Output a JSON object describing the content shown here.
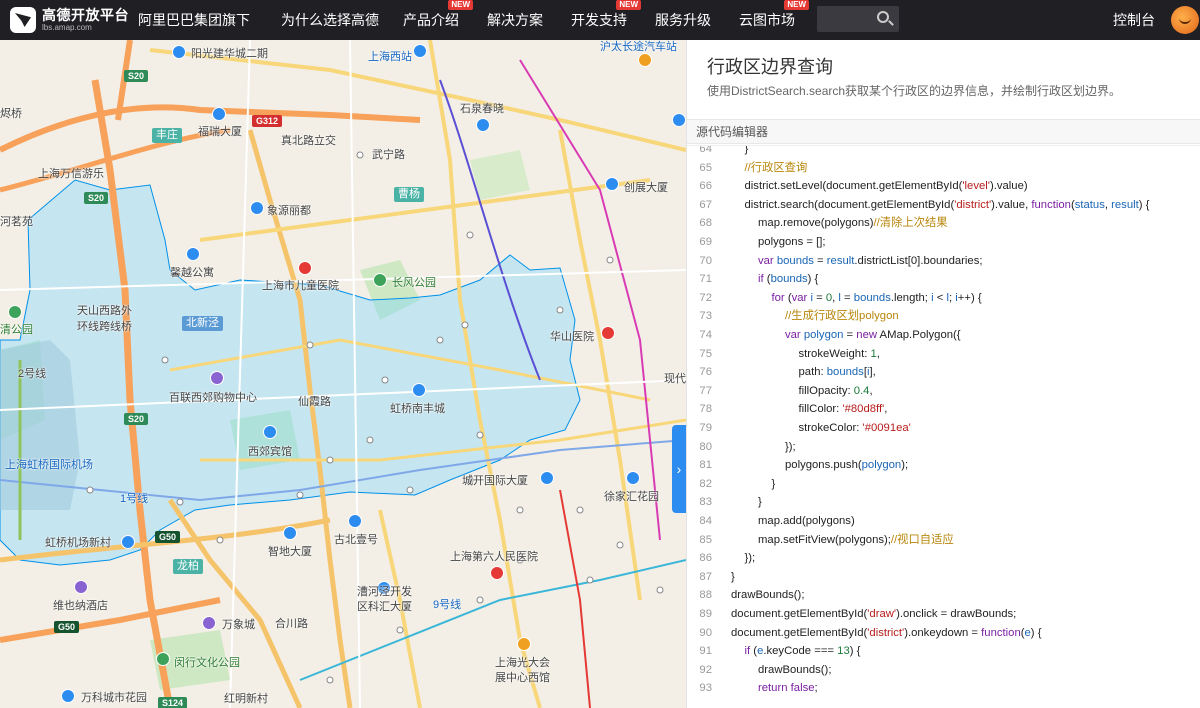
{
  "nav": {
    "logo_title": "高德开放平台",
    "logo_sub": "lbs.amap.com",
    "items": [
      {
        "label": "阿里巴巴集团旗下",
        "badge": ""
      },
      {
        "label": "为什么选择高德",
        "badge": ""
      },
      {
        "label": "产品介绍",
        "badge": "NEW"
      },
      {
        "label": "解决方案",
        "badge": ""
      },
      {
        "label": "开发支持",
        "badge": "NEW"
      },
      {
        "label": "服务升级",
        "badge": ""
      },
      {
        "label": "云图市场",
        "badge": "NEW"
      }
    ],
    "console": "控制台",
    "icons": {
      "search": "search-icon",
      "avatar": "avatar"
    }
  },
  "map": {
    "labels": [
      {
        "text": "阳光建华城二期",
        "cls": ""
      },
      {
        "text": "上海西站",
        "cls": "blue"
      },
      {
        "text": "沪太长途汽车站",
        "cls": "blue"
      },
      {
        "text": "石泉春晓",
        "cls": ""
      },
      {
        "text": "福瑞大厦",
        "cls": ""
      },
      {
        "text": "真北路立交",
        "cls": ""
      },
      {
        "text": "武宁路",
        "cls": ""
      },
      {
        "text": "上海万信游乐",
        "cls": ""
      },
      {
        "text": "创展大厦",
        "cls": ""
      },
      {
        "text": "象源丽都",
        "cls": ""
      },
      {
        "text": "馨越公寓",
        "cls": ""
      },
      {
        "text": "上海市儿童医院",
        "cls": ""
      },
      {
        "text": "长风公园",
        "cls": "green"
      },
      {
        "text": "天山西路外",
        "cls": ""
      },
      {
        "text": "环线跨线桥",
        "cls": ""
      },
      {
        "text": "华山医院",
        "cls": ""
      },
      {
        "text": "清公园",
        "cls": "green"
      },
      {
        "text": "百联西郊购物中心",
        "cls": ""
      },
      {
        "text": "仙霞路",
        "cls": ""
      },
      {
        "text": "虹桥南丰城",
        "cls": ""
      },
      {
        "text": "现代",
        "cls": ""
      },
      {
        "text": "西郊宾馆",
        "cls": ""
      },
      {
        "text": "上海虹桥国际机场",
        "cls": "blue"
      },
      {
        "text": "城开国际大厦",
        "cls": ""
      },
      {
        "text": "徐家汇花园",
        "cls": ""
      },
      {
        "text": "虹桥机场新村",
        "cls": ""
      },
      {
        "text": "智地大厦",
        "cls": ""
      },
      {
        "text": "古北壹号",
        "cls": ""
      },
      {
        "text": "上海第六人民医院",
        "cls": ""
      },
      {
        "text": "维也纳酒店",
        "cls": ""
      },
      {
        "text": "漕河泾开发",
        "cls": ""
      },
      {
        "text": "区科汇大厦",
        "cls": ""
      },
      {
        "text": "万象城",
        "cls": ""
      },
      {
        "text": "闵行文化公园",
        "cls": "green"
      },
      {
        "text": "上海光大会",
        "cls": ""
      },
      {
        "text": "展中心西馆",
        "cls": ""
      },
      {
        "text": "万科城市花园",
        "cls": ""
      },
      {
        "text": "红明新村",
        "cls": ""
      },
      {
        "text": "河茗苑",
        "cls": ""
      },
      {
        "text": "烬桥",
        "cls": ""
      },
      {
        "text": "合川路",
        "cls": ""
      },
      {
        "text": "9号线",
        "cls": "blue"
      },
      {
        "text": "1号线",
        "cls": "blue"
      },
      {
        "text": "2号线",
        "cls": ""
      }
    ],
    "shields": [
      {
        "text": "S20",
        "cls": "green"
      },
      {
        "text": "G312",
        "cls": "red"
      },
      {
        "text": "S20",
        "cls": "green"
      },
      {
        "text": "S20",
        "cls": "green"
      },
      {
        "text": "G50",
        "cls": "darkgreen"
      },
      {
        "text": "G50",
        "cls": "darkgreen"
      },
      {
        "text": "S124",
        "cls": "green"
      }
    ],
    "district_tags": [
      {
        "text": "丰庄",
        "cls": "teal"
      },
      {
        "text": "曹杨",
        "cls": "teal"
      },
      {
        "text": "北新泾",
        "cls": "blue"
      },
      {
        "text": "龙柏",
        "cls": "teal"
      }
    ],
    "polygon_fill": "#80d8ff",
    "polygon_stroke": "#0091ea",
    "collapse_icon": "chevron-right-icon"
  },
  "panel": {
    "title": "行政区边界查询",
    "desc": "使用DistrictSearch.search获取某个行政区的边界信息，并绘制行政区划边界。",
    "editor_header": "源代码编辑器"
  },
  "code_lines": [
    {
      "n": "64",
      "indent": 1,
      "parts": [
        [
          "",
          "}"
        ]
      ]
    },
    {
      "n": "65",
      "indent": 1,
      "parts": [
        [
          "cmt",
          "//行政区查询"
        ]
      ]
    },
    {
      "n": "66",
      "indent": 1,
      "parts": [
        [
          "",
          "district.setLevel(document.getElementById("
        ],
        [
          "str",
          "'level'"
        ],
        [
          "",
          ").value)"
        ]
      ]
    },
    {
      "n": "67",
      "indent": 1,
      "parts": [
        [
          "",
          "district.search(document.getElementById("
        ],
        [
          "str",
          "'district'"
        ],
        [
          "",
          ").value, "
        ],
        [
          "kw",
          "function"
        ],
        [
          "",
          "("
        ],
        [
          "var",
          "status"
        ],
        [
          "",
          ", "
        ],
        [
          "var",
          "result"
        ],
        [
          "",
          ") {"
        ]
      ]
    },
    {
      "n": "68",
      "indent": 2,
      "parts": [
        [
          "",
          "map.remove(polygons)"
        ],
        [
          "cmt",
          "//清除上次结果"
        ]
      ]
    },
    {
      "n": "69",
      "indent": 2,
      "parts": [
        [
          "",
          "polygons = [];"
        ]
      ]
    },
    {
      "n": "70",
      "indent": 2,
      "parts": [
        [
          "kw",
          "var "
        ],
        [
          "var",
          "bounds"
        ],
        [
          "",
          " = "
        ],
        [
          "var",
          "result"
        ],
        [
          "",
          ".districtList[0].boundaries;"
        ]
      ]
    },
    {
      "n": "71",
      "indent": 2,
      "parts": [
        [
          "kw",
          "if"
        ],
        [
          "",
          " ("
        ],
        [
          "var",
          "bounds"
        ],
        [
          "",
          ") {"
        ]
      ]
    },
    {
      "n": "72",
      "indent": 3,
      "parts": [
        [
          "kw",
          "for"
        ],
        [
          "",
          " ("
        ],
        [
          "kw",
          "var "
        ],
        [
          "var",
          "i"
        ],
        [
          "",
          " = "
        ],
        [
          "num",
          "0"
        ],
        [
          "",
          ", "
        ],
        [
          "var",
          "l"
        ],
        [
          "",
          " = "
        ],
        [
          "var",
          "bounds"
        ],
        [
          "",
          ".length; "
        ],
        [
          "var",
          "i"
        ],
        [
          "",
          " < "
        ],
        [
          "var",
          "l"
        ],
        [
          "",
          "; "
        ],
        [
          "var",
          "i"
        ],
        [
          "",
          "++) {"
        ]
      ]
    },
    {
      "n": "73",
      "indent": 4,
      "parts": [
        [
          "cmt",
          "//生成行政区划polygon"
        ]
      ]
    },
    {
      "n": "74",
      "indent": 4,
      "parts": [
        [
          "kw",
          "var "
        ],
        [
          "var",
          "polygon"
        ],
        [
          "",
          " = "
        ],
        [
          "kw",
          "new"
        ],
        [
          "",
          " AMap.Polygon({"
        ]
      ]
    },
    {
      "n": "75",
      "indent": 5,
      "parts": [
        [
          "",
          "strokeWeight: "
        ],
        [
          "num",
          "1"
        ],
        [
          "",
          ","
        ]
      ]
    },
    {
      "n": "76",
      "indent": 5,
      "parts": [
        [
          "",
          "path: "
        ],
        [
          "var",
          "bounds"
        ],
        [
          "",
          "["
        ],
        [
          "var",
          "i"
        ],
        [
          "",
          "],"
        ]
      ]
    },
    {
      "n": "77",
      "indent": 5,
      "parts": [
        [
          "",
          "fillOpacity: "
        ],
        [
          "num",
          "0.4"
        ],
        [
          "",
          ","
        ]
      ]
    },
    {
      "n": "78",
      "indent": 5,
      "parts": [
        [
          "",
          "fillColor: "
        ],
        [
          "str",
          "'#80d8ff'"
        ],
        [
          "",
          ","
        ]
      ]
    },
    {
      "n": "79",
      "indent": 5,
      "parts": [
        [
          "",
          "strokeColor: "
        ],
        [
          "str",
          "'#0091ea'"
        ]
      ]
    },
    {
      "n": "80",
      "indent": 4,
      "parts": [
        [
          "",
          "});"
        ]
      ]
    },
    {
      "n": "81",
      "indent": 4,
      "parts": [
        [
          "",
          "polygons.push("
        ],
        [
          "var",
          "polygon"
        ],
        [
          "",
          ");"
        ]
      ]
    },
    {
      "n": "82",
      "indent": 3,
      "parts": [
        [
          "",
          "}"
        ]
      ]
    },
    {
      "n": "83",
      "indent": 2,
      "parts": [
        [
          "",
          "}"
        ]
      ]
    },
    {
      "n": "84",
      "indent": 2,
      "parts": [
        [
          "",
          "map.add(polygons)"
        ]
      ]
    },
    {
      "n": "85",
      "indent": 2,
      "parts": [
        [
          "",
          "map.setFitView(polygons);"
        ],
        [
          "cmt",
          "//视口自适应"
        ]
      ]
    },
    {
      "n": "86",
      "indent": 1,
      "parts": [
        [
          "",
          "});"
        ]
      ]
    },
    {
      "n": "87",
      "indent": 0,
      "parts": [
        [
          "",
          "}"
        ]
      ]
    },
    {
      "n": "88",
      "indent": 0,
      "parts": [
        [
          "",
          "drawBounds();"
        ]
      ]
    },
    {
      "n": "89",
      "indent": 0,
      "parts": [
        [
          "",
          "document.getElementById("
        ],
        [
          "str",
          "'draw'"
        ],
        [
          "",
          ").onclick = drawBounds;"
        ]
      ]
    },
    {
      "n": "90",
      "indent": 0,
      "parts": [
        [
          "",
          "document.getElementById("
        ],
        [
          "str",
          "'district'"
        ],
        [
          "",
          ").onkeydown = "
        ],
        [
          "kw",
          "function"
        ],
        [
          "",
          "("
        ],
        [
          "var",
          "e"
        ],
        [
          "",
          ") {"
        ]
      ]
    },
    {
      "n": "91",
      "indent": 1,
      "parts": [
        [
          "kw",
          "if"
        ],
        [
          "",
          " ("
        ],
        [
          "var",
          "e"
        ],
        [
          "",
          ".keyCode === "
        ],
        [
          "num",
          "13"
        ],
        [
          "",
          ") {"
        ]
      ]
    },
    {
      "n": "92",
      "indent": 2,
      "parts": [
        [
          "",
          "drawBounds();"
        ]
      ]
    },
    {
      "n": "93",
      "indent": 2,
      "parts": [
        [
          "kw",
          "return false"
        ],
        [
          "",
          ";"
        ]
      ]
    }
  ]
}
